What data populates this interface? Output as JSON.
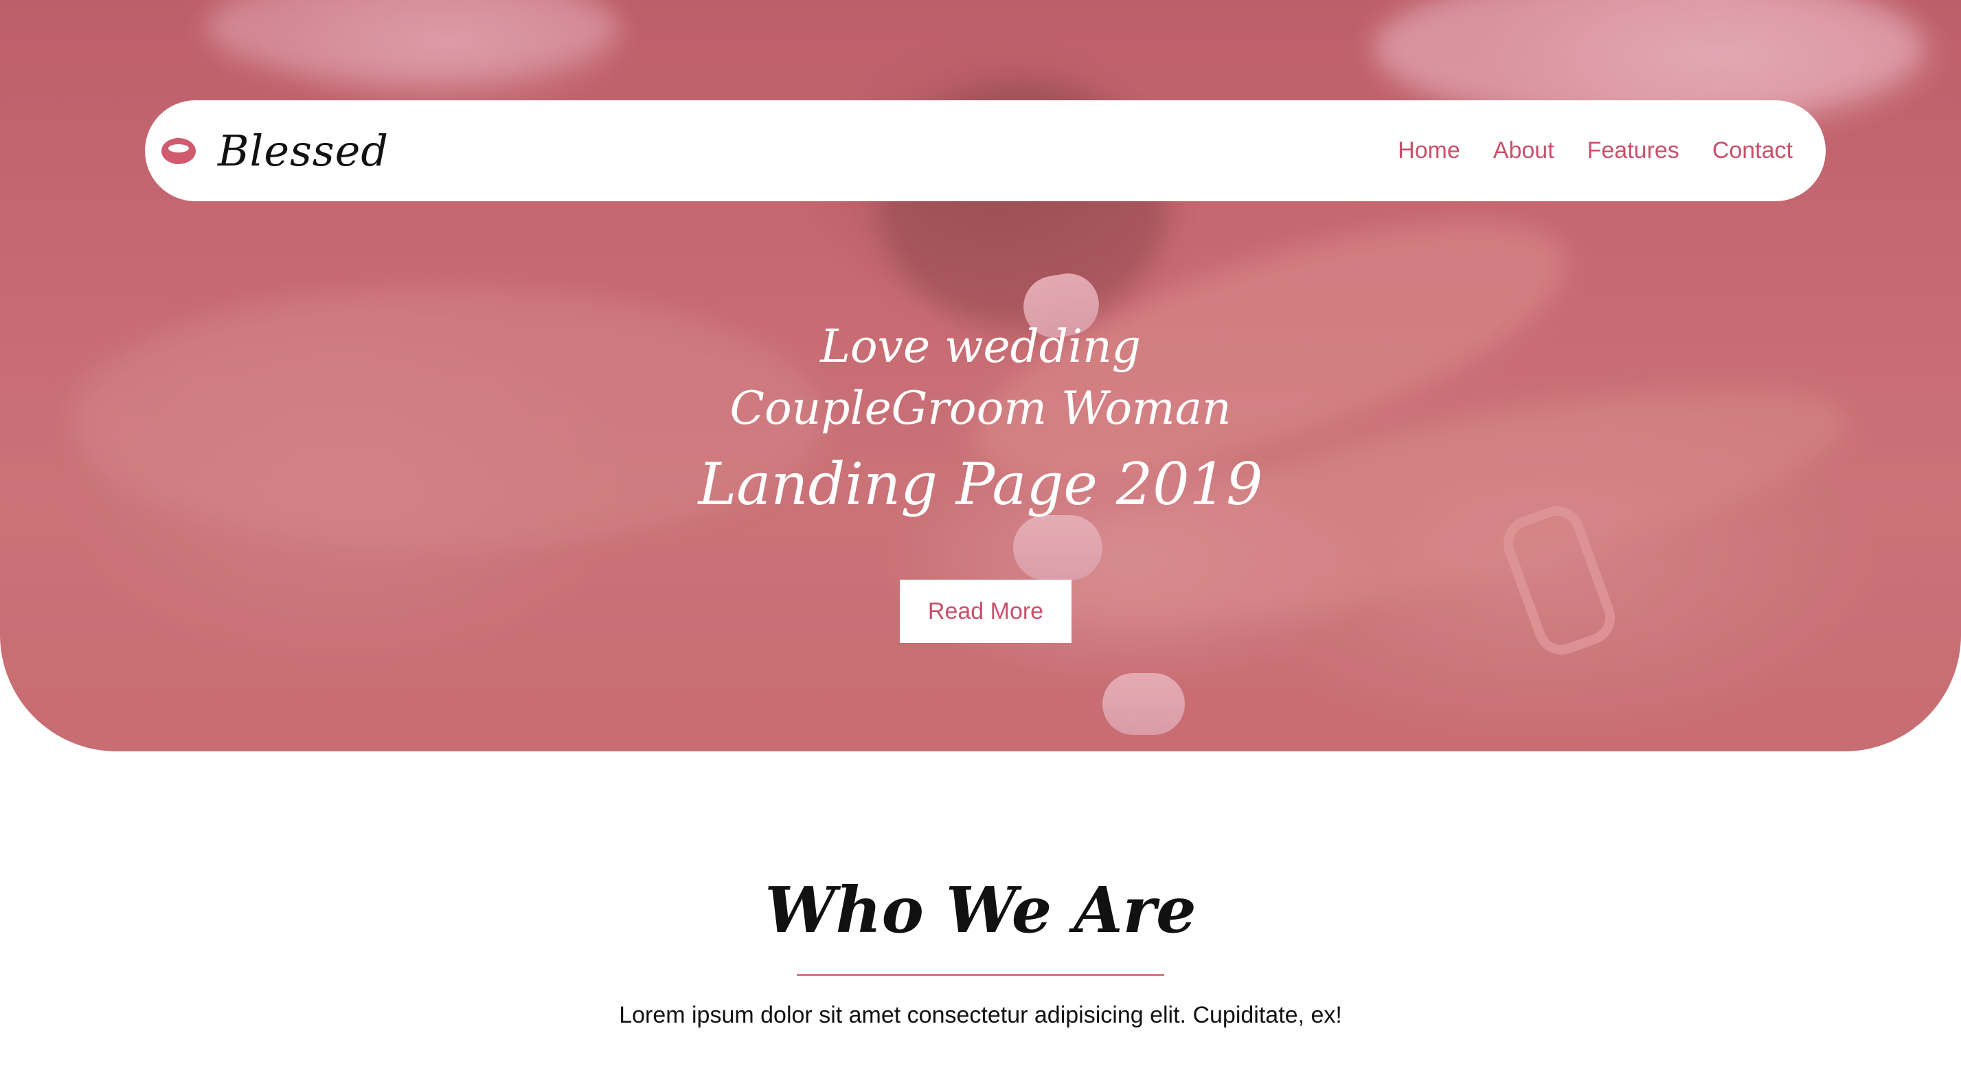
{
  "brand": {
    "name": "Blessed",
    "icon": "ring-icon"
  },
  "nav": {
    "items": [
      {
        "label": "Home"
      },
      {
        "label": "About"
      },
      {
        "label": "Features"
      },
      {
        "label": "Contact"
      }
    ]
  },
  "hero": {
    "line1": "Love wedding CoupleGroom Woman",
    "line2": "Landing Page 2019",
    "button_label": "Read More"
  },
  "who": {
    "title": "Who We Are",
    "text": "Lorem ipsum dolor sit amet consectetur adipisicing elit. Cupiditate, ex!"
  },
  "colors": {
    "accent": "#c9506a",
    "hero_overlay": "#ce5c6c",
    "underline": "#d57a8a"
  }
}
